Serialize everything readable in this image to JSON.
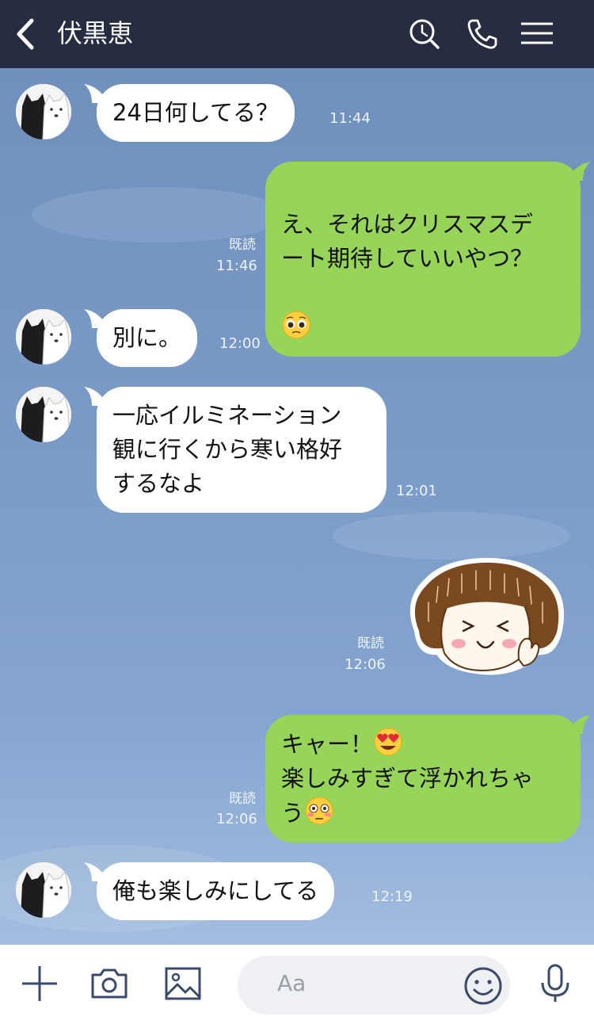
{
  "header": {
    "title": "伏黒恵",
    "icons": [
      "back-chevron-icon",
      "search-icon",
      "phone-icon",
      "menu-icon"
    ]
  },
  "messages": [
    {
      "side": "in",
      "text": "24日何してる？",
      "time": "11:44"
    },
    {
      "side": "out",
      "text": "え、それはクリスマスデ\nート期待していいやつ？",
      "emoji": "pleading-face",
      "read": "既読",
      "time": "11:46"
    },
    {
      "side": "in",
      "text": "別に。",
      "time": "12:00"
    },
    {
      "side": "in",
      "text": "一応イルミネーション\n観に行くから寒い格好\nするなよ",
      "time": "12:01"
    },
    {
      "side": "out",
      "type": "sticker",
      "sticker": "girl-sticker",
      "read": "既読",
      "time": "12:06"
    },
    {
      "side": "out",
      "text_line1": "キャー！",
      "emoji_line1": "heart-eyes",
      "text_line2": "楽しみすぎて浮かれちゃ",
      "text_line3": "う",
      "emoji_line3": "flushed-face",
      "read": "既読",
      "time": "12:06"
    },
    {
      "side": "in",
      "text": "俺も楽しみにしてる",
      "time": "12:19"
    }
  ],
  "composer": {
    "placeholder": "Aa",
    "icons": [
      "plus-icon",
      "camera-icon",
      "image-icon",
      "smiley-icon",
      "microphone-icon"
    ]
  },
  "colors": {
    "header_bg": "#262d40",
    "chat_bg": "#7d9dc9",
    "outgoing_bubble": "#97d45a",
    "incoming_bubble": "#ffffff"
  }
}
